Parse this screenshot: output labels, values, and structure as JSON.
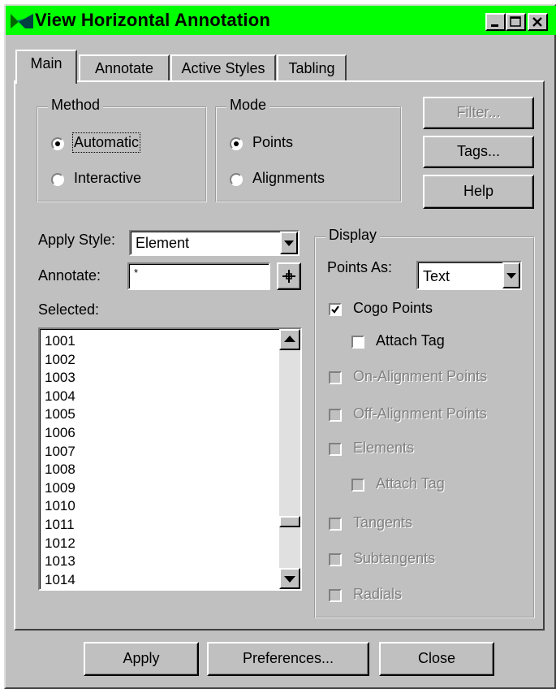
{
  "window": {
    "title": "View Horizontal Annotation"
  },
  "tabs": [
    "Main",
    "Annotate",
    "Active Styles",
    "Tabling"
  ],
  "method": {
    "legend": "Method",
    "options": [
      "Automatic",
      "Interactive"
    ],
    "selected": "Automatic"
  },
  "mode": {
    "legend": "Mode",
    "options": [
      "Points",
      "Alignments"
    ],
    "selected": "Points"
  },
  "side_buttons": {
    "filter": "Filter...",
    "tags": "Tags...",
    "help": "Help"
  },
  "apply_style": {
    "label": "Apply Style:",
    "value": "Element"
  },
  "annotate": {
    "label": "Annotate:",
    "value": "*"
  },
  "selected": {
    "label": "Selected:",
    "items": [
      "1001",
      "1002",
      "1003",
      "1004",
      "1005",
      "1006",
      "1007",
      "1008",
      "1009",
      "1010",
      "1011",
      "1012",
      "1013",
      "1014"
    ]
  },
  "display": {
    "legend": "Display",
    "points_as_label": "Points As:",
    "points_as_value": "Text",
    "options": [
      {
        "label": "Cogo Points",
        "checked": true,
        "enabled": true
      },
      {
        "label": "Attach Tag",
        "checked": false,
        "enabled": true
      },
      {
        "label": "On-Alignment Points",
        "checked": false,
        "enabled": false
      },
      {
        "label": "Off-Alignment Points",
        "checked": false,
        "enabled": false
      },
      {
        "label": "Elements",
        "checked": false,
        "enabled": false
      },
      {
        "label": "Attach Tag",
        "checked": false,
        "enabled": false
      },
      {
        "label": "Tangents",
        "checked": false,
        "enabled": false
      },
      {
        "label": "Subtangents",
        "checked": false,
        "enabled": false
      },
      {
        "label": "Radials",
        "checked": false,
        "enabled": false
      }
    ]
  },
  "footer": {
    "apply": "Apply",
    "preferences": "Preferences...",
    "close": "Close"
  },
  "colors": {
    "title_bar": "#00ff00",
    "face": "#c0c0c0",
    "disabled_text": "#808080"
  }
}
